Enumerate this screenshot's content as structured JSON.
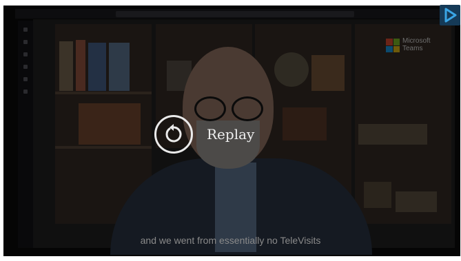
{
  "player": {
    "overlay": {
      "replay_label": "Replay",
      "icon": "replay-icon"
    },
    "caption": "and we went from essentially no TeleVisits",
    "watermark": {
      "brand_line1": "Microsoft",
      "brand_line2": "Teams"
    },
    "corner_button_icon": "play-logo-icon"
  },
  "colors": {
    "overlay_text": "#eeeeee",
    "caption_text": "#8a8a8a",
    "ms_red": "#6b2418",
    "ms_green": "#3c5a12",
    "ms_blue": "#0c4a6e",
    "ms_yellow": "#6e5a0a",
    "corner_button": "#153a57"
  }
}
